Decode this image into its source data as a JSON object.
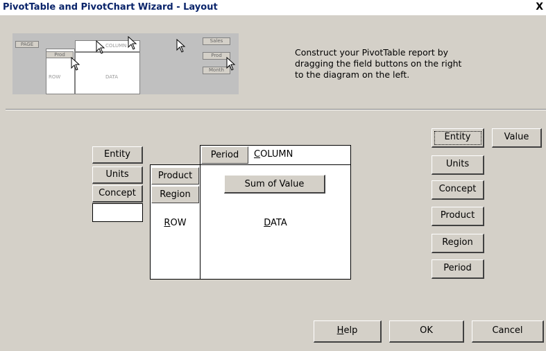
{
  "window": {
    "title": "PivotTable and PivotChart Wizard - Layout",
    "close_label": "X"
  },
  "preview": {
    "page_label": "PAGE",
    "row_field": "Prod",
    "column_label": "COLUMN",
    "row_label": "ROW",
    "data_label": "DATA",
    "buttons": [
      "Sales",
      "Prod",
      "Month"
    ]
  },
  "instructions": "Construct your PivotTable report by\ndragging the field buttons on the right\nto the diagram on the left.",
  "page_area": {
    "fields": [
      "Entity",
      "Units",
      "Concept"
    ]
  },
  "row_area": {
    "fields": [
      "Product",
      "Region"
    ],
    "label_underline": "R",
    "label_rest": "OW"
  },
  "column_area": {
    "field": "Period",
    "label_underline": "C",
    "label_rest": "OLUMN"
  },
  "data_area": {
    "field": "Sum of Value",
    "label_underline": "D",
    "label_rest": "ATA"
  },
  "field_list": {
    "entity": "Entity",
    "value": "Value",
    "units": "Units",
    "concept": "Concept",
    "product": "Product",
    "region": "Region",
    "period": "Period"
  },
  "buttons": {
    "help_underline": "H",
    "help_rest": "elp",
    "ok": "OK",
    "cancel": "Cancel"
  }
}
